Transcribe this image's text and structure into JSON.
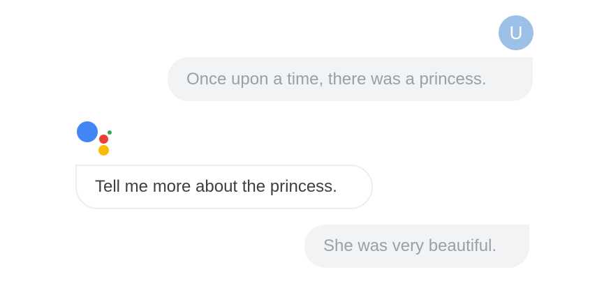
{
  "colors": {
    "avatar_bg": "#9dc1e6",
    "user_bubble_bg": "#f1f3f4",
    "user_text": "#9aa0a6",
    "assistant_text": "#3c4043",
    "assistant_border": "#eceeef",
    "logo_blue": "#4285f4",
    "logo_red": "#ea4335",
    "logo_yellow": "#fbbc05",
    "logo_green": "#34a853"
  },
  "user": {
    "avatar_initial": "U"
  },
  "assistant": {
    "logo_icon": "google-assistant-dots-icon"
  },
  "messages": [
    {
      "role": "user",
      "text": "Once upon a time, there was a princess."
    },
    {
      "role": "assistant",
      "text": "Tell me more about the princess."
    },
    {
      "role": "user",
      "text": "She was very beautiful."
    }
  ]
}
